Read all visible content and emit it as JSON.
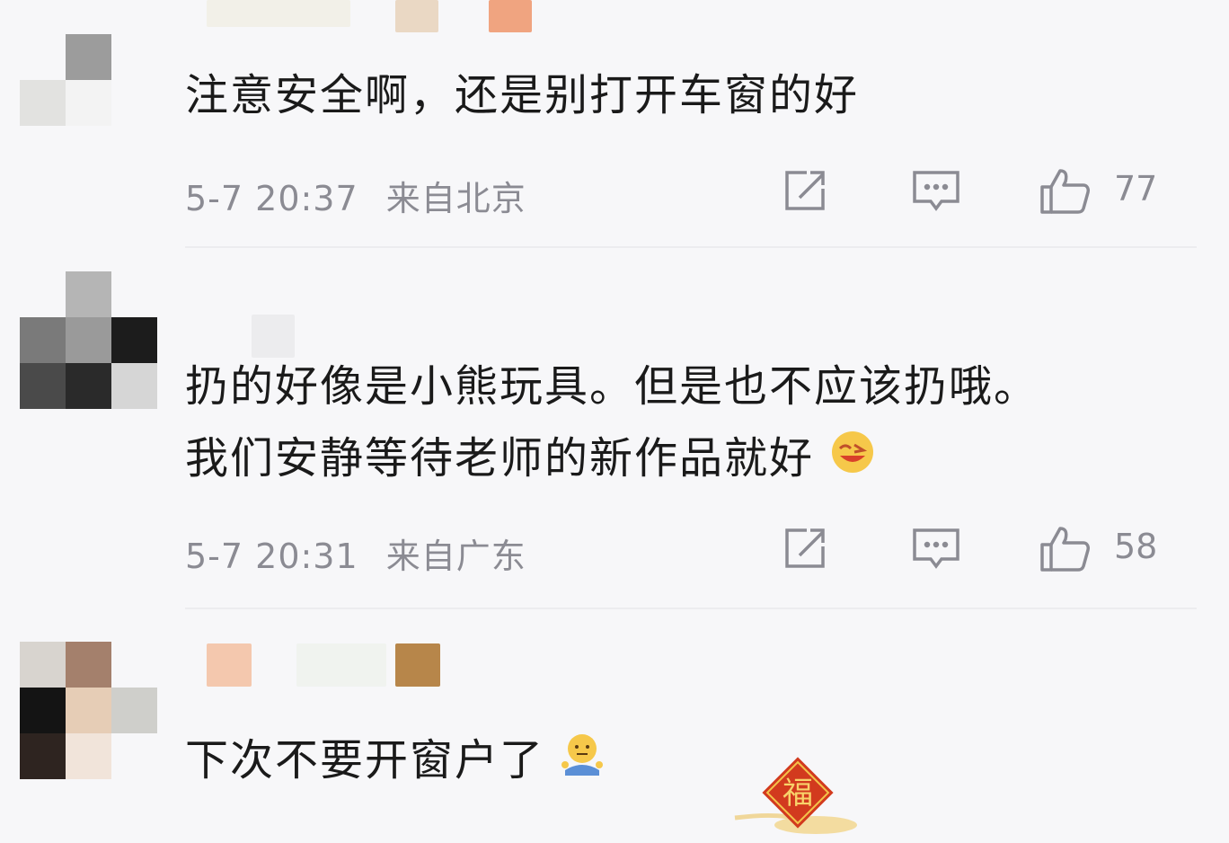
{
  "comments": [
    {
      "text": "注意安全啊，还是别打开车窗的好",
      "time": "5-7 20:37",
      "location": "来自北京",
      "likes": "77",
      "avatar_color": "#bdbdbd"
    },
    {
      "text_line1": "扔的好像是小熊玩具。但是也不应该扔哦。",
      "text_line2": "我们安静等待老师的新作品就好",
      "emoji": "grin-emoji",
      "time": "5-7 20:31",
      "location": "来自广东",
      "likes": "58",
      "avatar_color": "#555555"
    },
    {
      "text": "下次不要开窗户了",
      "emoji": "shrug-emoji",
      "avatar_color": "#c8a58c",
      "badge_text": "福"
    }
  ],
  "icons": [
    "share-icon",
    "reply-icon",
    "like-icon"
  ]
}
